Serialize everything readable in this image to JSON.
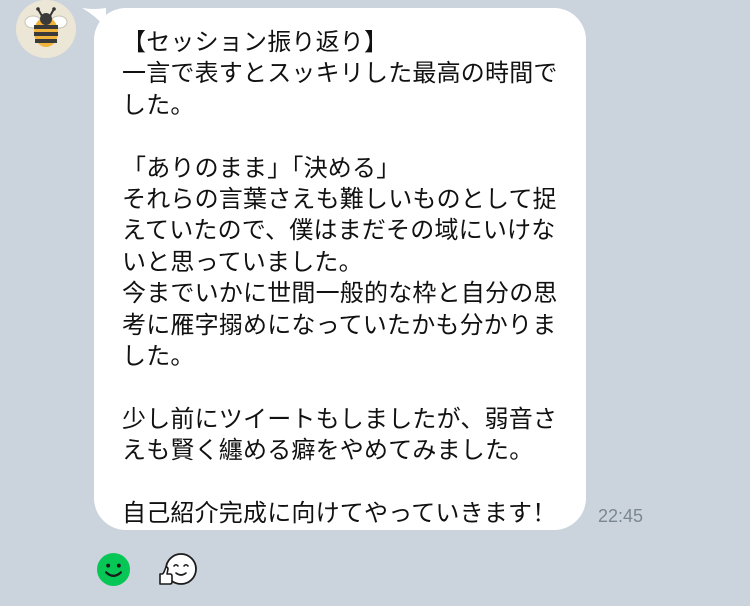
{
  "message": {
    "lines": [
      "【セッション振り返り】",
      "一言で表すとスッキリした最高の時間で",
      "した。",
      "",
      "「ありのまま」「決める」",
      "それらの言葉さえも難しいものとして捉",
      "えていたので、僕はまだその域にいけな",
      "いと思っていました。",
      "今までいかに世間一般的な枠と自分の思",
      "考に雁字搦めになっていたかも分かりま",
      "した。",
      "",
      "少し前にツイートもしましたが、弱音さ",
      "えも賢く纏める癖をやめてみました。",
      "",
      "自己紹介完成に向けてやっていきます！"
    ],
    "time": "22:45"
  },
  "avatar": {
    "icon": "bee-icon"
  },
  "reactions": [
    {
      "icon": "smile-emoji-icon",
      "color": "#06c755"
    },
    {
      "icon": "thumbs-up-face-sticker-icon"
    }
  ],
  "colors": {
    "background": "#cbd4dd",
    "bubble": "#ffffff",
    "text": "#111111",
    "timestamp": "#7b8792"
  }
}
